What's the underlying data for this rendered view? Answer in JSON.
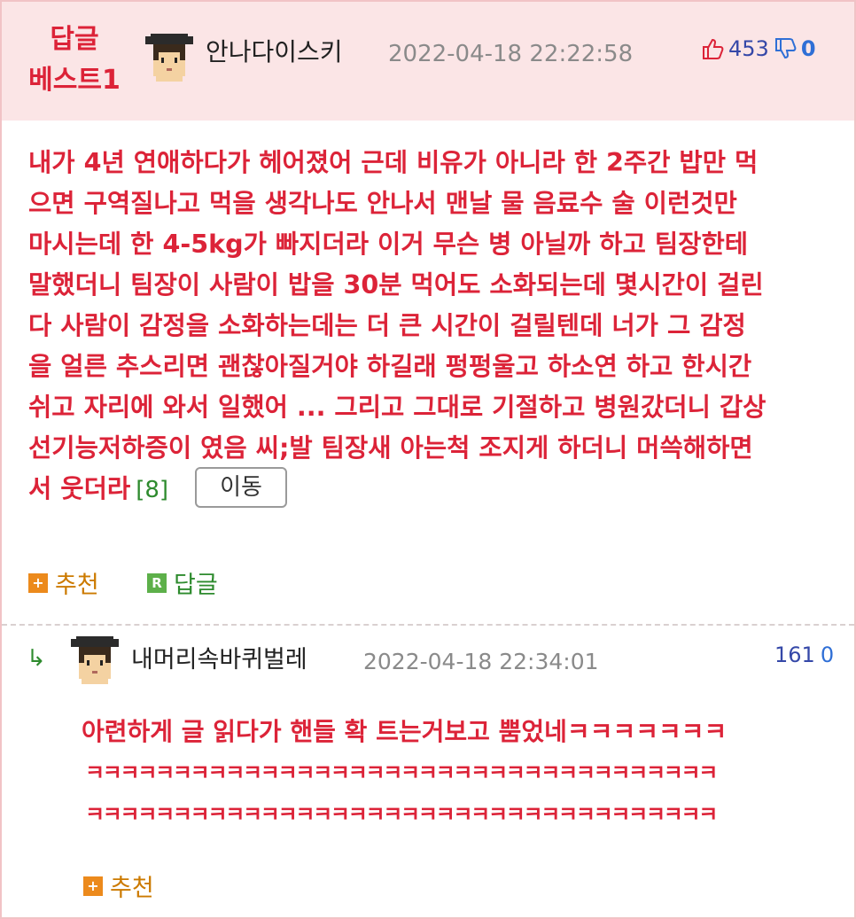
{
  "best_comment": {
    "badge_line1": "답글",
    "badge_line2": "베스트1",
    "author": "안나다이스키",
    "datetime": "2022-04-18 22:22:58",
    "likes": "453",
    "dislikes": "0",
    "body_lines": [
      "내가 4년 연애하다가 헤어졌어 근데 비유가 아니라 한 2주간 밥만 먹",
      "으면 구역질나고 먹을 생각나도 안나서 맨날 물 음료수 술 이런것만",
      "마시는데 한 4-5kg가 빠지더라 이거 무슨 병 아닐까 하고 팀장한테",
      "말했더니 팀장이 사람이 밥을 30분 먹어도 소화되는데 몇시간이 걸린",
      "다 사람이 감정을 소화하는데는 더 큰 시간이 걸릴텐데 너가 그 감정",
      "을 얼른 추스리면 괜찮아질거야 하길래 펑펑울고 하소연 하고 한시간",
      "쉬고 자리에 와서 일했어 ... 그리고 그대로 기절하고 병원갔더니 갑상",
      "선기능저하증이 였음 씨;발 팀장새 아는척 조지게 하더니 머쓱해하면",
      "서 웃더라"
    ],
    "reply_count": "[8]",
    "move_button": "이동",
    "recommend_label": "추천",
    "reply_label": "답글",
    "reply_icon_letter": "R"
  },
  "reply": {
    "arrow": "↳",
    "author": "내머리속바퀴벌레",
    "datetime": "2022-04-18 22:34:01",
    "likes": "161",
    "dislikes": "0",
    "body_lines": [
      "아련하게 글 읽다가 핸들 확 트는거보고 뿜었네ㅋㅋㅋㅋㅋㅋㅋ",
      "ㅋㅋㅋㅋㅋㅋㅋㅋㅋㅋㅋㅋㅋㅋㅋㅋㅋㅋㅋㅋㅋㅋㅋㅋㅋㅋㅋㅋㅋㅋㅋㅋㅋㅋㅋㅋ",
      "ㅋㅋㅋㅋㅋㅋㅋㅋㅋㅋㅋㅋㅋㅋㅋㅋㅋㅋㅋㅋㅋㅋㅋㅋㅋㅋㅋㅋㅋㅋㅋㅋㅋㅋㅋㅋ"
    ],
    "recommend_label": "추천"
  },
  "colors": {
    "accent_red": "#dc2338",
    "best_bg": "#fbe5e6",
    "count_green": "#2e8b2e",
    "recommend_orange": "#ec8a1c"
  },
  "icons": [
    "avatar-graduate-icon",
    "thumbs-up-icon",
    "thumbs-down-icon",
    "plus-icon",
    "reply-r-icon",
    "reply-arrow-icon"
  ]
}
